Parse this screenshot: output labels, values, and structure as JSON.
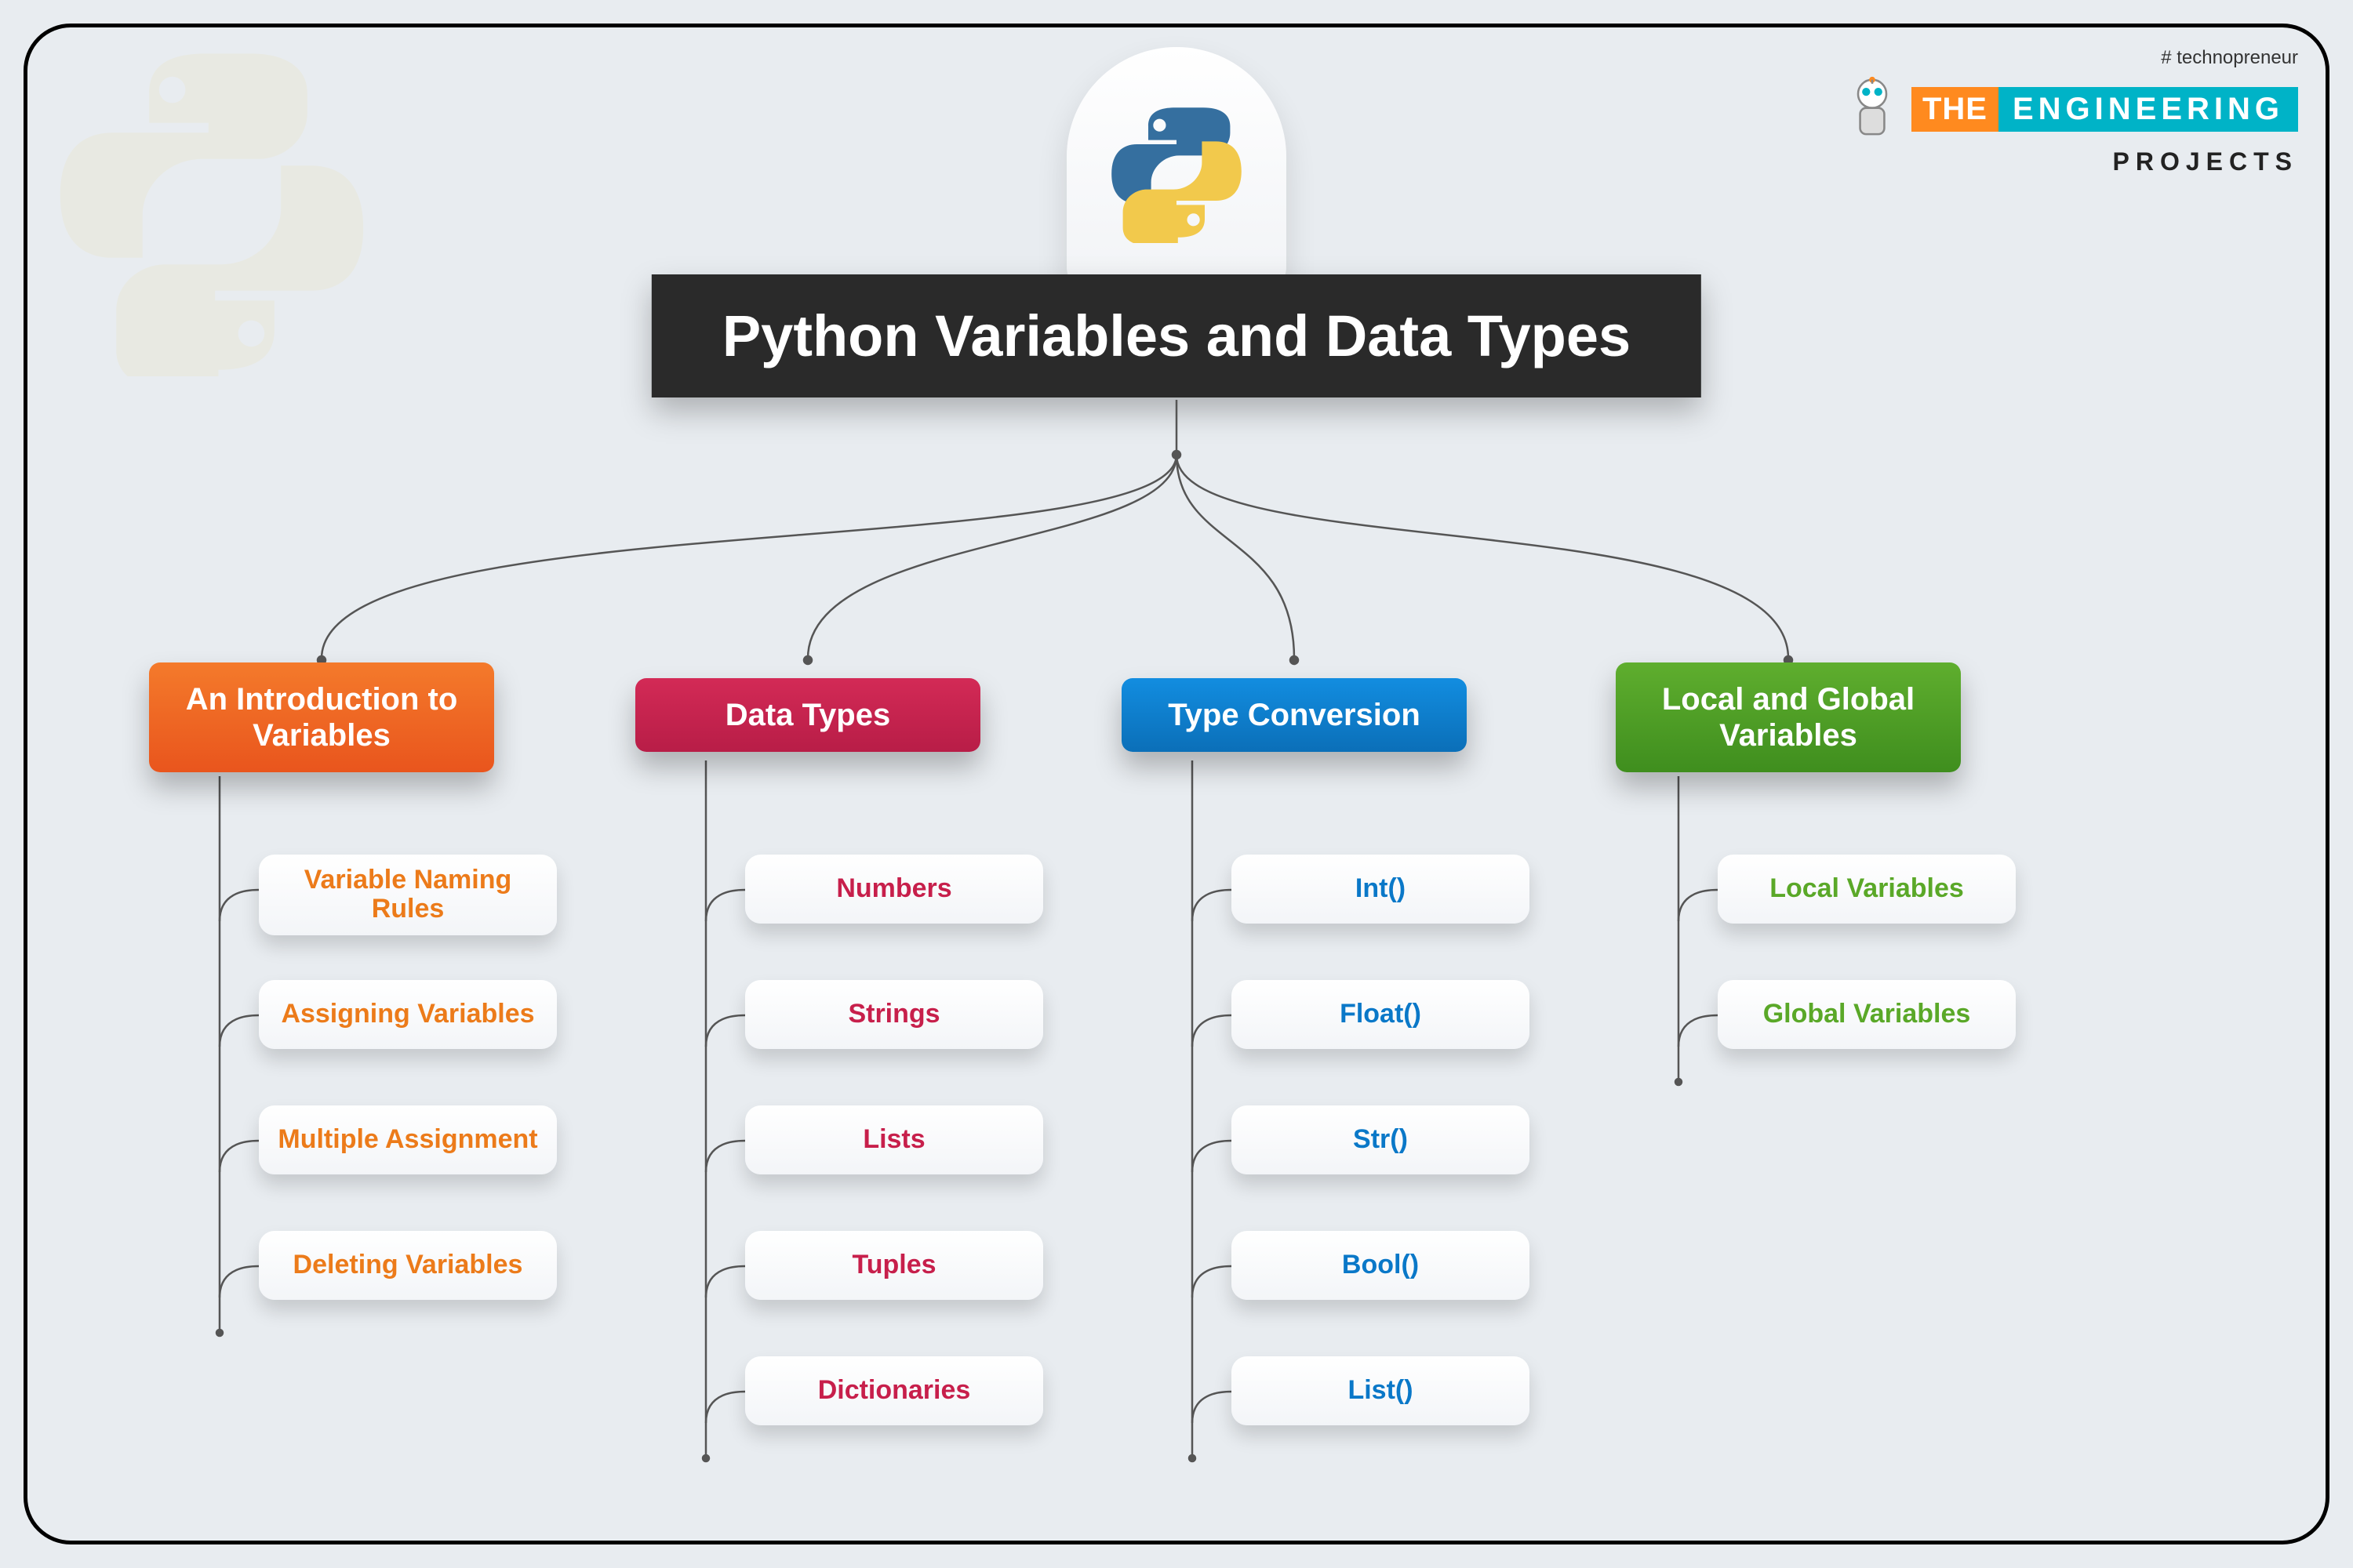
{
  "title": "Python Variables and Data Types",
  "brand": {
    "tag": "# technopreneur",
    "the": "THE",
    "eng": "ENGINEERING",
    "projects": "PROJECTS"
  },
  "branches": [
    {
      "label": "An Introduction to Variables",
      "color": "orange",
      "children": [
        "Variable Naming Rules",
        "Assigning Variables",
        "Multiple Assignment",
        "Deleting Variables"
      ]
    },
    {
      "label": "Data Types",
      "color": "red",
      "children": [
        "Numbers",
        "Strings",
        "Lists",
        "Tuples",
        "Dictionaries"
      ]
    },
    {
      "label": "Type Conversion",
      "color": "blue",
      "children": [
        "Int()",
        "Float()",
        "Str()",
        "Bool()",
        "List()"
      ]
    },
    {
      "label": "Local and Global Variables",
      "color": "green",
      "children": [
        "Local Variables",
        "Global Variables"
      ]
    }
  ]
}
